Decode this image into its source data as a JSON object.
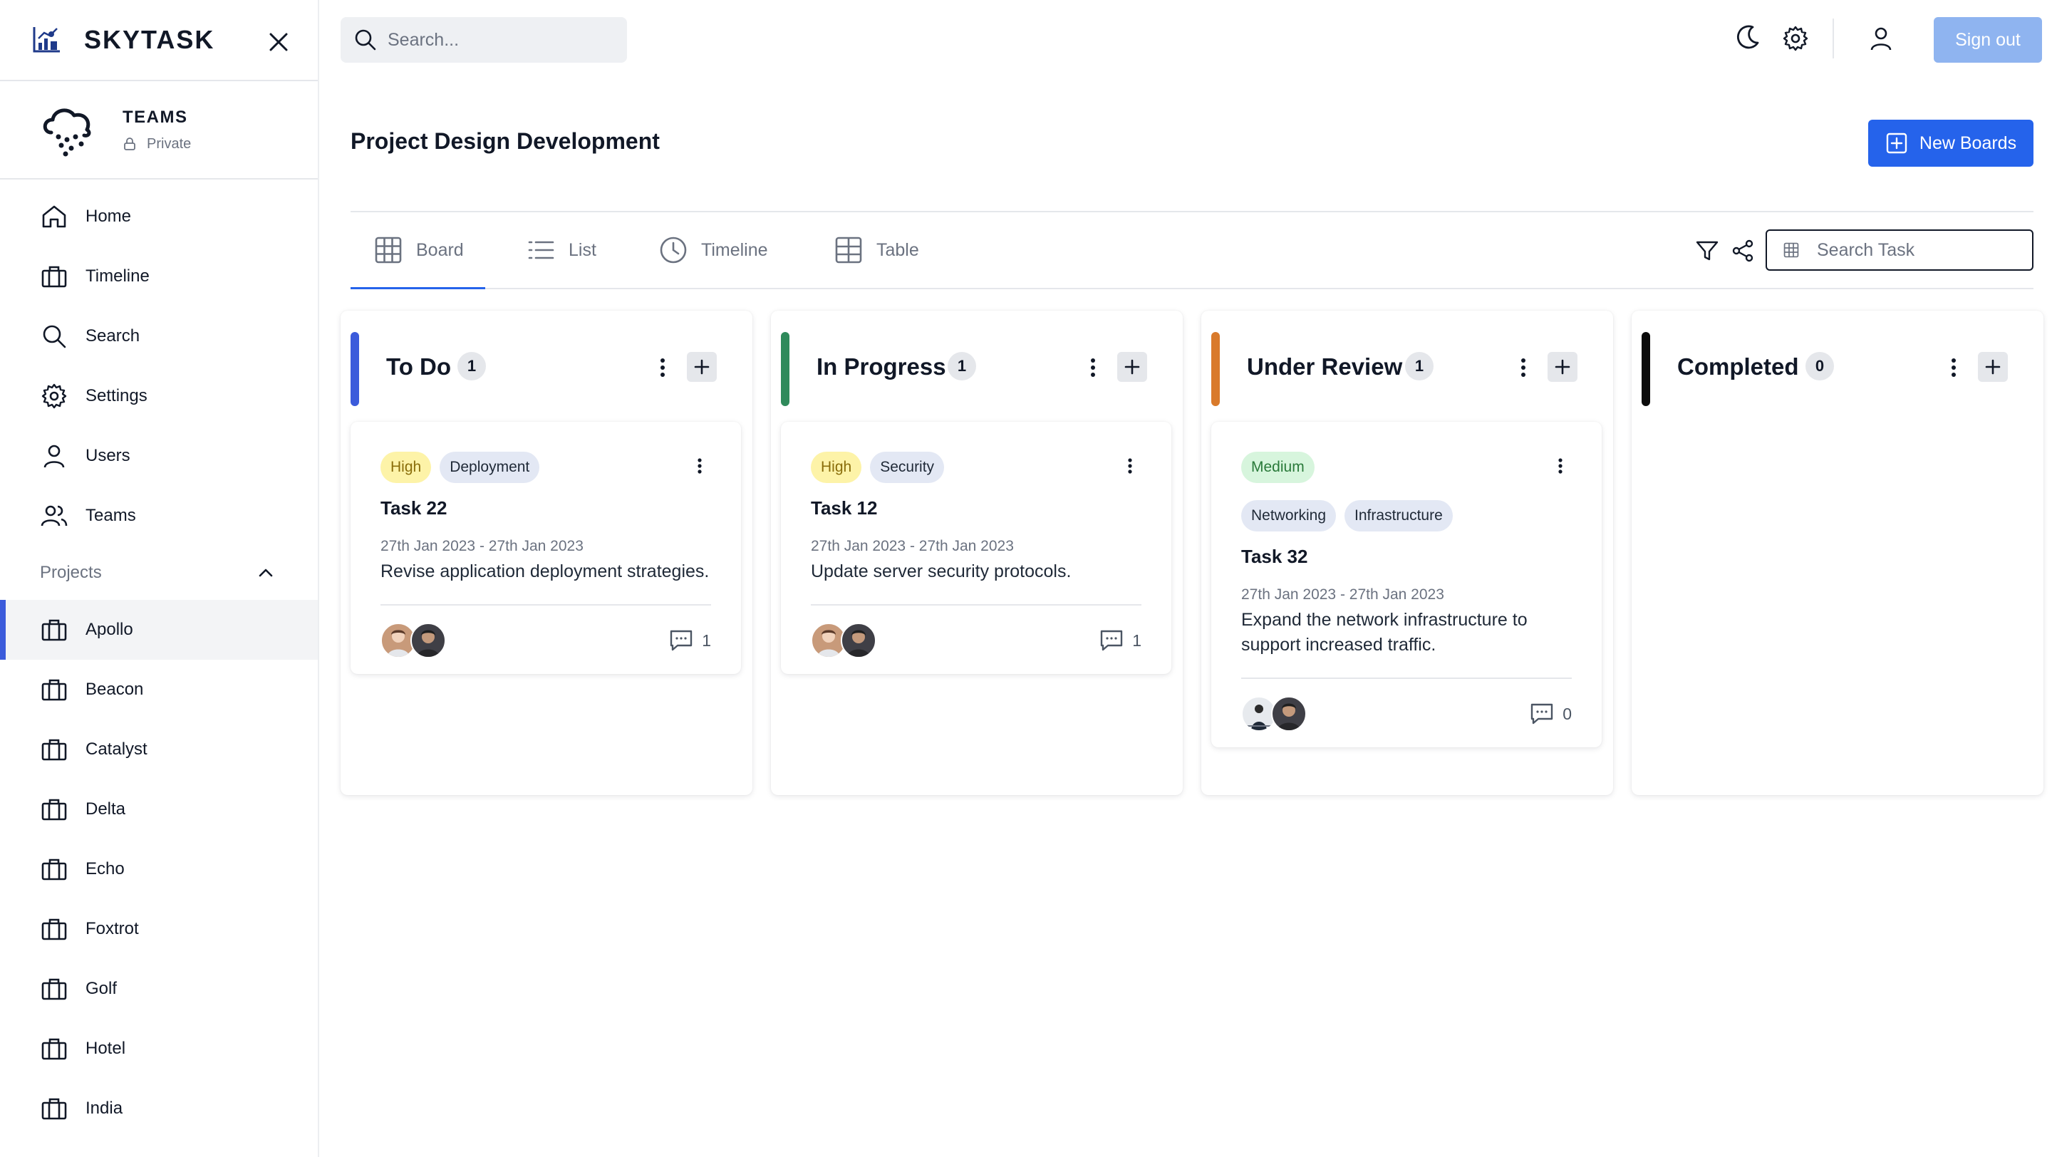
{
  "brand": {
    "name": "SKYTASK"
  },
  "team": {
    "name": "TEAMS",
    "visibility": "Private"
  },
  "nav": {
    "items": [
      {
        "label": "Home",
        "icon": "home-icon"
      },
      {
        "label": "Timeline",
        "icon": "briefcase-icon"
      },
      {
        "label": "Search",
        "icon": "search-icon"
      },
      {
        "label": "Settings",
        "icon": "gear-icon"
      },
      {
        "label": "Users",
        "icon": "user-icon"
      },
      {
        "label": "Teams",
        "icon": "users-icon"
      }
    ],
    "projects_label": "Projects",
    "projects": [
      "Apollo",
      "Beacon",
      "Catalyst",
      "Delta",
      "Echo",
      "Foxtrot",
      "Golf",
      "Hotel",
      "India"
    ],
    "active_project": "Apollo"
  },
  "topbar": {
    "search_placeholder": "Search...",
    "signout_label": "Sign out"
  },
  "page": {
    "title": "Project Design Development",
    "new_boards_label": "New Boards"
  },
  "tabs": [
    {
      "label": "Board",
      "icon": "grid-icon",
      "active": true
    },
    {
      "label": "List",
      "icon": "list-icon",
      "active": false
    },
    {
      "label": "Timeline",
      "icon": "clock-icon",
      "active": false
    },
    {
      "label": "Table",
      "icon": "table-icon",
      "active": false
    }
  ],
  "task_search": {
    "placeholder": "Search Task"
  },
  "columns": [
    {
      "title": "To Do",
      "count": "1",
      "color": "#3b5bdb",
      "cards": [
        {
          "tags": [
            "High",
            "Deployment"
          ],
          "title": "Task 22",
          "date": "27th Jan 2023 - 27th Jan 2023",
          "description": "Revise application deployment strategies.",
          "comments": "1"
        }
      ]
    },
    {
      "title": "In Progress",
      "count": "1",
      "color": "#2f8a5b",
      "cards": [
        {
          "tags": [
            "High",
            "Security"
          ],
          "title": "Task 12",
          "date": "27th Jan 2023 - 27th Jan 2023",
          "description": "Update server security protocols.",
          "comments": "1"
        }
      ]
    },
    {
      "title": "Under Review",
      "count": "1",
      "color": "#d97a2b",
      "cards": [
        {
          "tags": [
            "Medium",
            "Networking",
            "Infrastructure"
          ],
          "title": "Task 32",
          "date": "27th Jan 2023 - 27th Jan 2023",
          "description": "Expand the network infrastructure to support increased traffic.",
          "comments": "0"
        }
      ]
    },
    {
      "title": "Completed",
      "count": "0",
      "color": "#0b0b0b",
      "cards": []
    }
  ]
}
